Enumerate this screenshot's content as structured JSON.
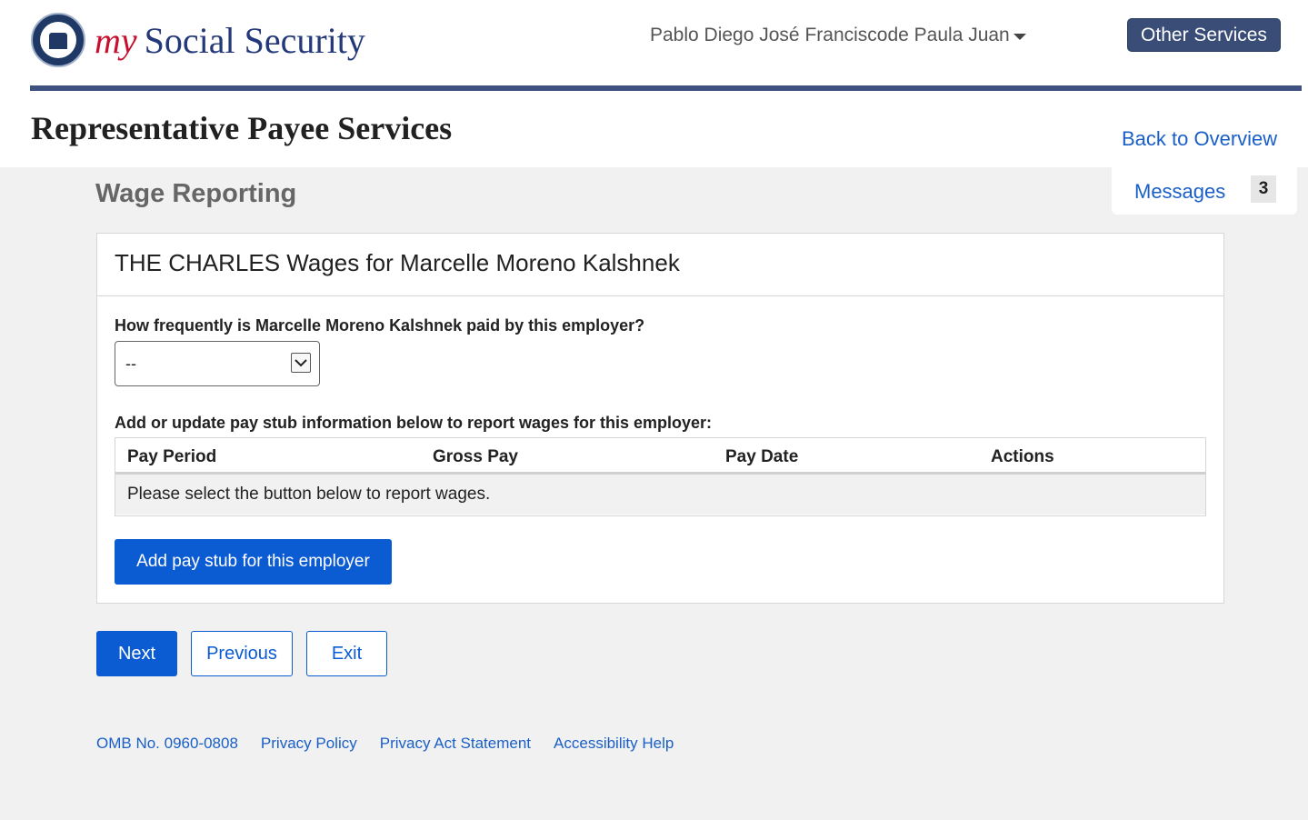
{
  "brand": {
    "my": "my",
    "name": "Social Security"
  },
  "user": {
    "name": "Pablo Diego José Franciscode Paula Juan"
  },
  "header": {
    "other_services": "Other Services"
  },
  "page": {
    "title": "Representative Payee Services",
    "back_link": "Back  to Overview",
    "messages_label": "Messages",
    "messages_count": "3",
    "section_title": "Wage Reporting"
  },
  "panel": {
    "heading": "THE CHARLES Wages for Marcelle Moreno Kalshnek",
    "frequency_question": "How frequently is Marcelle Moreno Kalshnek paid by this employer?",
    "frequency_value": "--",
    "table_intro": "Add or update pay stub information below to report wages for this employer:",
    "columns": [
      "Pay Period",
      "Gross Pay",
      "Pay Date",
      "Actions"
    ],
    "empty_message": "Please select the button below to report wages.",
    "add_button": "Add pay stub for this employer"
  },
  "nav": {
    "next": "Next",
    "previous": "Previous",
    "exit": "Exit"
  },
  "footer": {
    "links": [
      "OMB No. 0960-0808",
      "Privacy Policy",
      "Privacy Act Statement",
      "Accessibility Help"
    ]
  }
}
